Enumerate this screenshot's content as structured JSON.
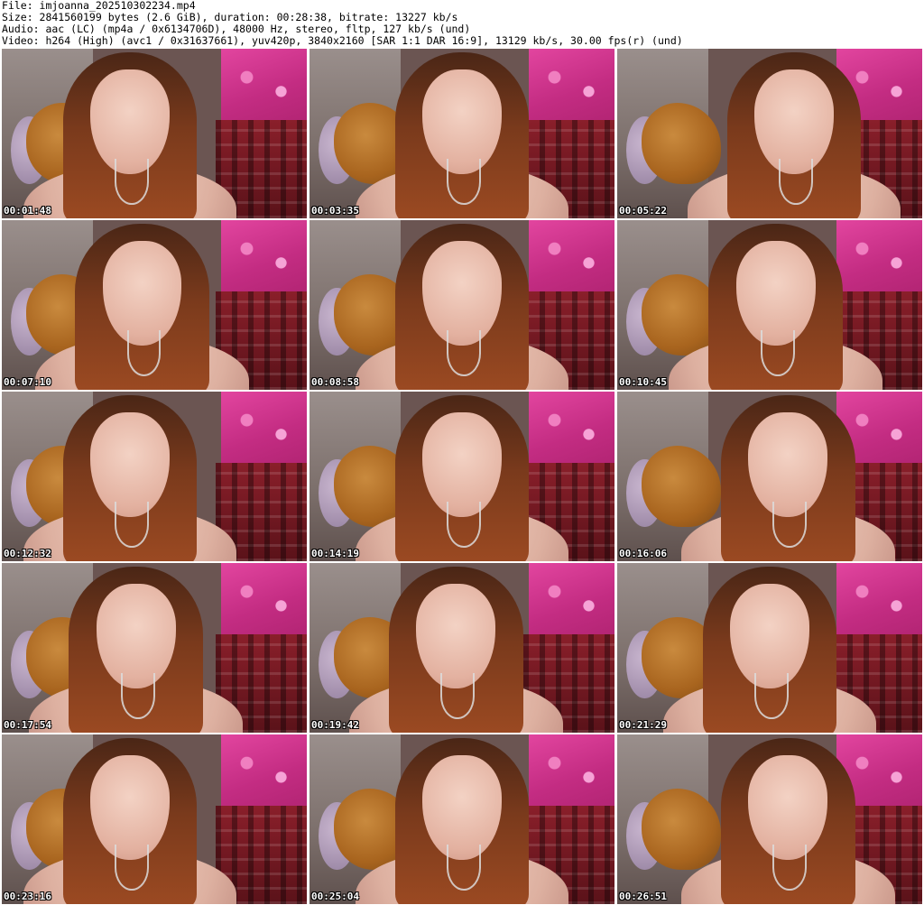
{
  "header": {
    "file_line": "File: imjoanna_202510302234.mp4",
    "size_line": "Size: 2841560199 bytes (2.6 GiB), duration: 00:28:38, bitrate: 13227 kb/s",
    "audio_line": "Audio: aac (LC) (mp4a / 0x6134706D), 48000 Hz, stereo, fltp, 127 kb/s (und)",
    "video_line": "Video: h264 (High) (avc1 / 0x31637661), yuv420p, 3840x2160 [SAR 1:1 DAR 16:9], 13129 kb/s, 30.00 fps(r) (und)"
  },
  "thumbnails": [
    {
      "timestamp": "00:01:48"
    },
    {
      "timestamp": "00:03:35"
    },
    {
      "timestamp": "00:05:22"
    },
    {
      "timestamp": "00:07:10"
    },
    {
      "timestamp": "00:08:58"
    },
    {
      "timestamp": "00:10:45"
    },
    {
      "timestamp": "00:12:32"
    },
    {
      "timestamp": "00:14:19"
    },
    {
      "timestamp": "00:16:06"
    },
    {
      "timestamp": "00:17:54"
    },
    {
      "timestamp": "00:19:42"
    },
    {
      "timestamp": "00:21:29"
    },
    {
      "timestamp": "00:23:16"
    },
    {
      "timestamp": "00:25:04"
    },
    {
      "timestamp": "00:26:51"
    }
  ]
}
